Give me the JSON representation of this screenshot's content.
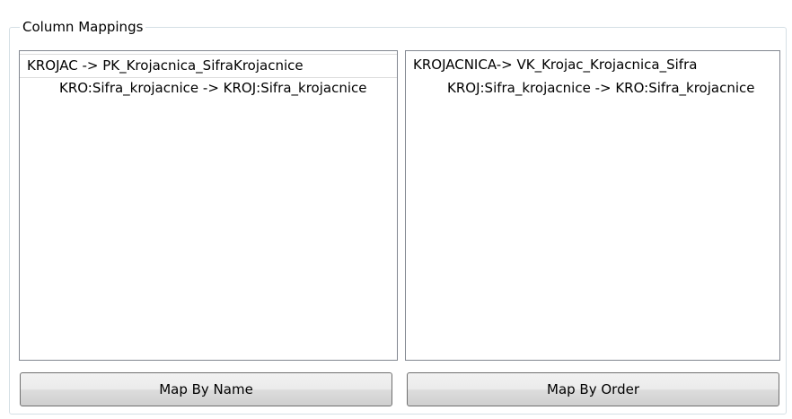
{
  "group": {
    "title": "Column Mappings"
  },
  "left_panel": {
    "parent": "KROJAC -> PK_Krojacnica_SifraKrojacnice",
    "child": "KRO:Sifra_krojacnice -> KROJ:Sifra_krojacnice",
    "button_label": "Map By Name"
  },
  "right_panel": {
    "parent": "KROJACNICA-> VK_Krojac_Krojacnica_Sifra",
    "child": "KROJ:Sifra_krojacnice -> KRO:Sifra_krojacnice",
    "button_label": "Map By Order"
  }
}
